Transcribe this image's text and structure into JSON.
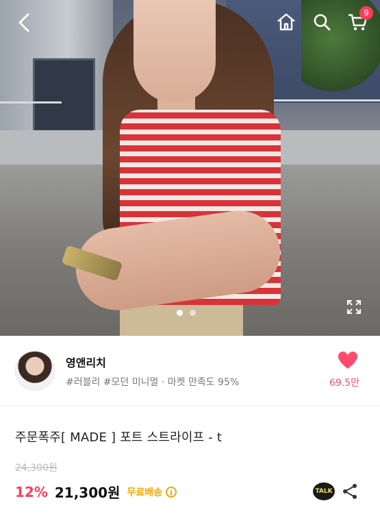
{
  "header": {
    "cart_count": "9",
    "icons": [
      "back-icon",
      "home-icon",
      "search-icon",
      "cart-icon",
      "expand-icon"
    ]
  },
  "gallery": {
    "dots": 2,
    "active_index": 0
  },
  "shop": {
    "name": "영앤리치",
    "tags": "#러블리 #모던 미니멀 · 마켓 만족도 95%",
    "likes": "69.5만"
  },
  "product": {
    "title": "주문폭주[ MADE ] 포트 스트라이프 - t",
    "original_price": "24,300원",
    "discount": "12%",
    "price": "21,300원",
    "shipping": "무료배송",
    "talk_label": "TALK"
  },
  "colors": {
    "accent": "#ff3b5c",
    "shipping": "#f5a500",
    "like": "#ff4b6e"
  }
}
